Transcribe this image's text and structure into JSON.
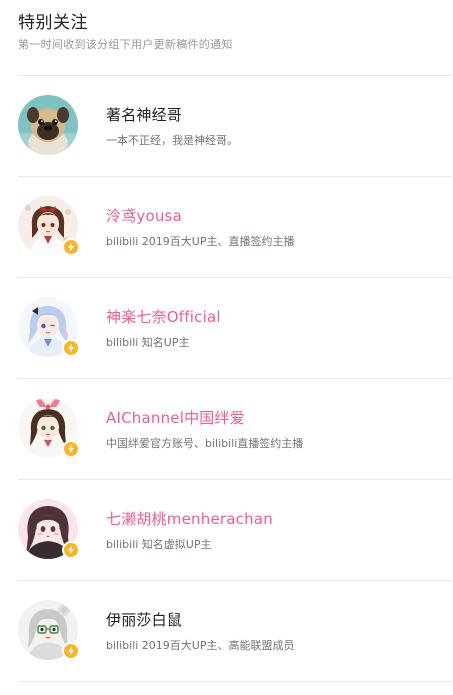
{
  "header": {
    "title": "特别关注",
    "subtitle": "第一时间收到该分组下用户更新稿件的通知"
  },
  "colors": {
    "vip_name": "#f25d8e",
    "plain_name": "#222222",
    "badge": "#f8b52b"
  },
  "users": [
    {
      "name": "著名神经哥",
      "desc": "一本不正经，我是神经哥。",
      "vip": false,
      "verified": false,
      "avatar_icon": "pug-dog-avatar"
    },
    {
      "name": "泠鸢yousa",
      "desc": "bilibili 2019百大UP主、直播签约主播",
      "vip": true,
      "verified": true,
      "avatar_icon": "anime-girl-avatar"
    },
    {
      "name": "神楽七奈Official",
      "desc": "bilibili 知名UP主",
      "vip": true,
      "verified": true,
      "avatar_icon": "anime-girl-avatar"
    },
    {
      "name": "AIChannel中国绊爱",
      "desc": "中国绊爱官方账号、bilibili直播签约主播",
      "vip": true,
      "verified": true,
      "avatar_icon": "anime-girl-avatar"
    },
    {
      "name": "七濑胡桃menherachan",
      "desc": "bilibili 知名虚拟UP主",
      "vip": true,
      "verified": true,
      "avatar_icon": "anime-girl-avatar"
    },
    {
      "name": "伊丽莎白鼠",
      "desc": "bilibili 2019百大UP主、高能联盟成员",
      "vip": false,
      "verified": true,
      "avatar_icon": "anime-girl-avatar"
    }
  ]
}
